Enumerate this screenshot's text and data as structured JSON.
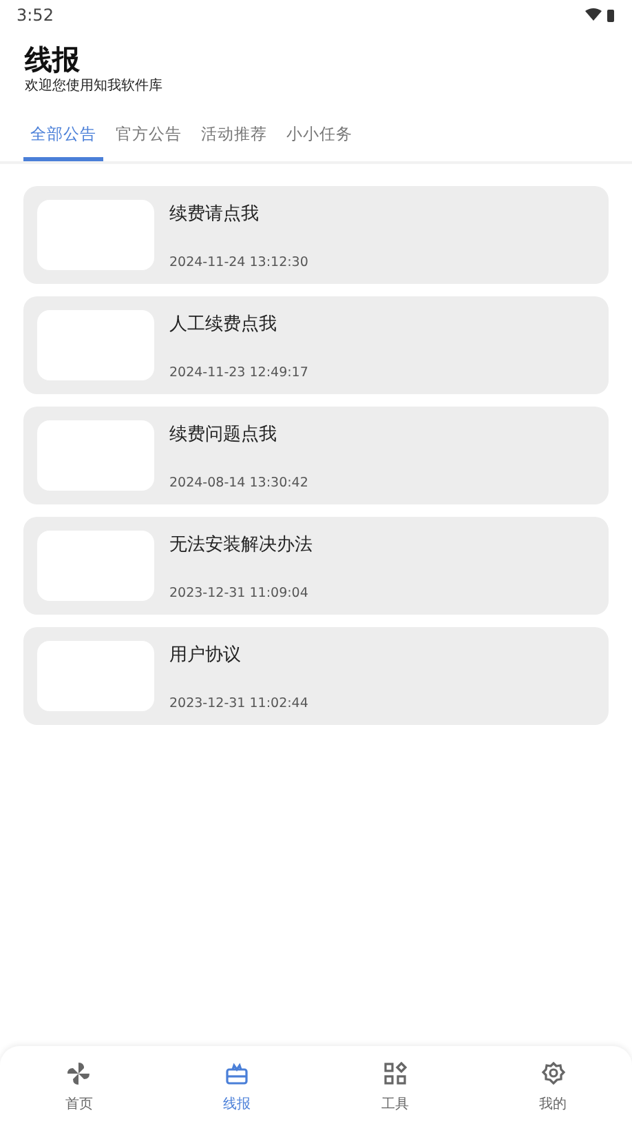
{
  "status_bar": {
    "time": "3:52"
  },
  "header": {
    "title": "线报",
    "subtitle": "欢迎您使用知我软件库"
  },
  "tabs": [
    {
      "label": "全部公告",
      "selected": true
    },
    {
      "label": "官方公告",
      "selected": false
    },
    {
      "label": "活动推荐",
      "selected": false
    },
    {
      "label": "小小任务",
      "selected": false
    }
  ],
  "posts": [
    {
      "title": "续费请点我",
      "date": "2024-11-24 13:12:30"
    },
    {
      "title": "人工续费点我",
      "date": "2024-11-23 12:49:17"
    },
    {
      "title": "续费问题点我",
      "date": "2024-08-14 13:30:42"
    },
    {
      "title": "无法安装解决办法",
      "date": "2023-12-31 11:09:04"
    },
    {
      "title": "用户协议",
      "date": "2023-12-31 11:02:44"
    }
  ],
  "bottom_nav": [
    {
      "label": "首页",
      "selected": false
    },
    {
      "label": "线报",
      "selected": true
    },
    {
      "label": "工具",
      "selected": false
    },
    {
      "label": "我的",
      "selected": false
    }
  ]
}
